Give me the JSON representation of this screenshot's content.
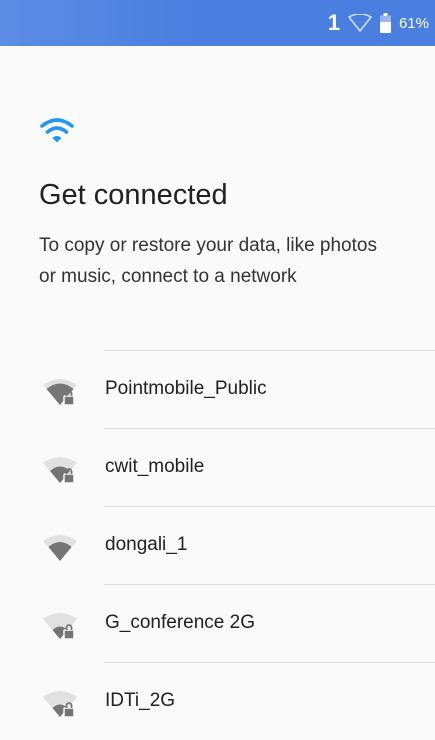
{
  "status_bar": {
    "sim_indicator": "1",
    "battery_percent": "61%",
    "background_color": "#4a7fe0",
    "icons": [
      "wifi-outline-icon",
      "battery-icon"
    ]
  },
  "header": {
    "icon": "wifi-icon",
    "icon_color": "#2196f3",
    "title": "Get connected",
    "subtitle": "To copy or restore your data, like photos or music, connect to a network"
  },
  "networks": [
    {
      "name": "Pointmobile_Public",
      "secured": true,
      "signal": 3
    },
    {
      "name": "cwit_mobile",
      "secured": true,
      "signal": 2
    },
    {
      "name": "dongali_1",
      "secured": false,
      "signal": 2
    },
    {
      "name": "G_conference 2G",
      "secured": true,
      "signal": 1
    },
    {
      "name": "IDTi_2G",
      "secured": true,
      "signal": 1
    }
  ]
}
